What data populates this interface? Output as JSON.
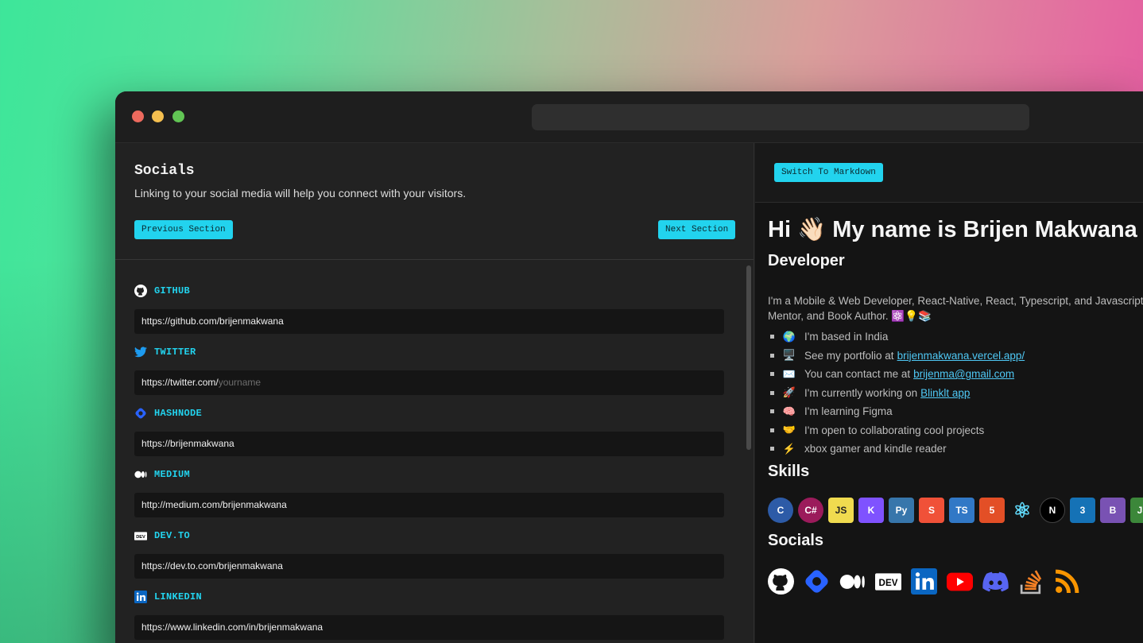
{
  "left": {
    "title": "Socials",
    "description": "Linking to your social media will help you connect with your visitors.",
    "prev_button": "Previous Section",
    "next_button": "Next Section",
    "fields": [
      {
        "label": "GITHUB",
        "icon": "github-icon",
        "value": "https://github.com/brijenmakwana",
        "placeholder": ""
      },
      {
        "label": "TWITTER",
        "icon": "twitter-icon",
        "value": "https://twitter.com/",
        "placeholder": "yourname"
      },
      {
        "label": "HASHNODE",
        "icon": "hashnode-icon",
        "value": "https://brijenmakwana",
        "placeholder": ""
      },
      {
        "label": "MEDIUM",
        "icon": "medium-icon",
        "value": "http://medium.com/brijenmakwana",
        "placeholder": ""
      },
      {
        "label": "DEV.TO",
        "icon": "devto-icon",
        "value": "https://dev.to.com/brijenmakwana",
        "placeholder": ""
      },
      {
        "label": "LINKEDIN",
        "icon": "linkedin-icon",
        "value": "https://www.linkedin.com/in/brijenmakwana",
        "placeholder": ""
      }
    ]
  },
  "right": {
    "switch_button": "Switch To Markdown",
    "heading": "Hi 👋🏻 My name is Brijen Makwana",
    "subheading": "Developer",
    "intro_line1": "I'm a Mobile & Web Developer, React-Native, React, Typescript, and Javascript",
    "intro_line2": "Mentor, and Book Author. ⚛️💡📚",
    "bullets": [
      {
        "emoji": "🌍",
        "text": "I'm based in India",
        "link": ""
      },
      {
        "emoji": "🖥️",
        "text": "See my portfolio at",
        "link": "brijenmakwana.vercel.app/"
      },
      {
        "emoji": "✉️",
        "text": "You can contact me at",
        "link": "brijenma@gmail.com"
      },
      {
        "emoji": "🚀",
        "text": "I'm currently working on",
        "link": "Blinklt app"
      },
      {
        "emoji": "🧠",
        "text": "I'm learning Figma",
        "link": ""
      },
      {
        "emoji": "🤝",
        "text": "I'm open to collaborating cool projects",
        "link": ""
      },
      {
        "emoji": "⚡",
        "text": "xbox gamer and kindle reader",
        "link": ""
      }
    ],
    "skills_heading": "Skills",
    "skills": [
      {
        "name": "c-icon",
        "text": "C",
        "color": "#2d5ba7"
      },
      {
        "name": "csharp-icon",
        "text": "C#",
        "color": "#9b1b5b"
      },
      {
        "name": "javascript-icon",
        "text": "JS",
        "color": "#f0db4f"
      },
      {
        "name": "kotlin-icon",
        "text": "K",
        "color": "#7f52ff"
      },
      {
        "name": "python-icon",
        "text": "Py",
        "color": "#3776ab"
      },
      {
        "name": "swift-icon",
        "text": "S",
        "color": "#f05138"
      },
      {
        "name": "typescript-icon",
        "text": "TS",
        "color": "#3178c6"
      },
      {
        "name": "html5-icon",
        "text": "5",
        "color": "#e34f26"
      },
      {
        "name": "react-icon",
        "text": "⚛",
        "color": "#61dafb"
      },
      {
        "name": "nextjs-icon",
        "text": "N",
        "color": "#000000"
      },
      {
        "name": "css3-icon",
        "text": "3",
        "color": "#1572b6"
      },
      {
        "name": "bootstrap-icon",
        "text": "B",
        "color": "#7952b3"
      },
      {
        "name": "nodejs-icon",
        "text": "JS",
        "color": "#3c873a"
      }
    ],
    "socials_heading": "Socials",
    "socials": [
      {
        "name": "github-icon",
        "color": "#ffffff"
      },
      {
        "name": "hashnode-icon",
        "color": "#2962ff"
      },
      {
        "name": "medium-icon",
        "color": "#ffffff"
      },
      {
        "name": "devto-icon",
        "color": "#ffffff"
      },
      {
        "name": "linkedin-icon",
        "color": "#0a66c2"
      },
      {
        "name": "youtube-icon",
        "color": "#ff0000"
      },
      {
        "name": "discord-icon",
        "color": "#5865f2"
      },
      {
        "name": "stackoverflow-icon",
        "color": "#f48024"
      },
      {
        "name": "rss-icon",
        "color": "#f99500"
      }
    ]
  }
}
